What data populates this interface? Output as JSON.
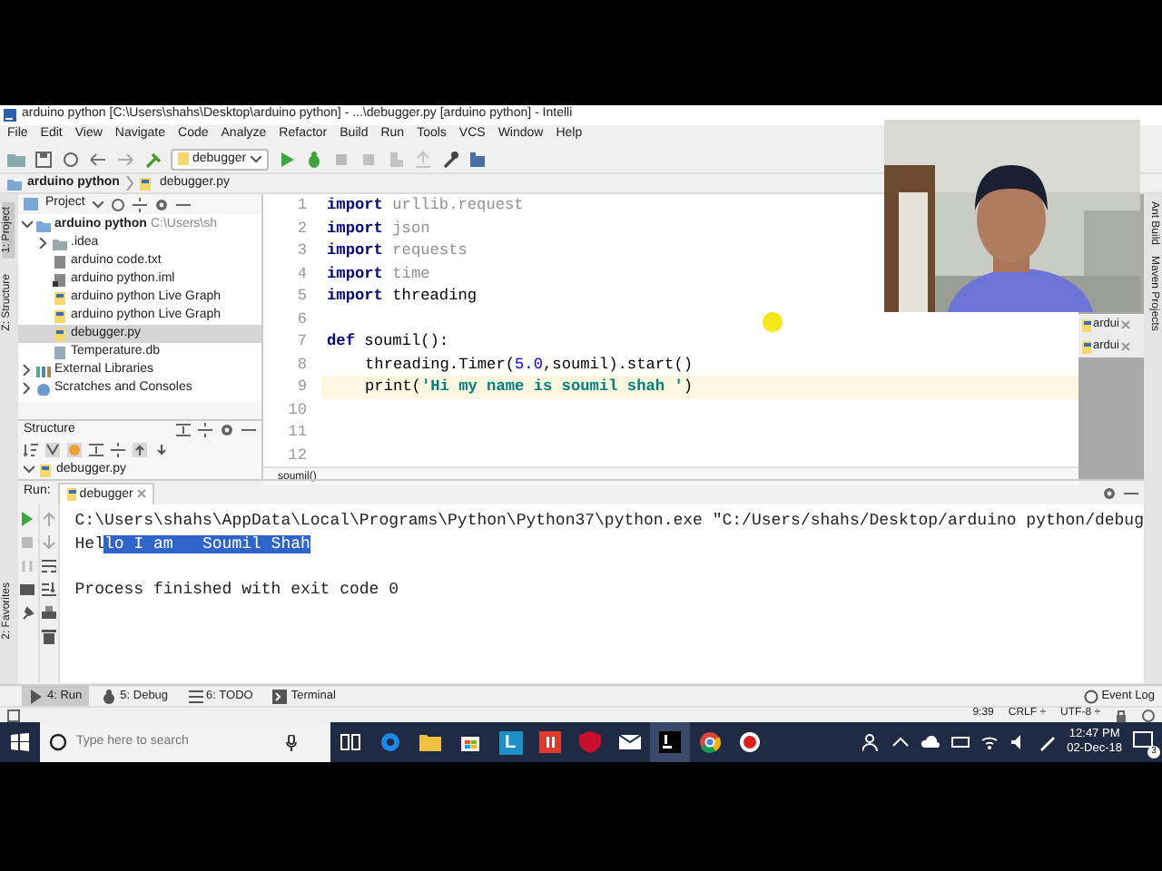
{
  "window": {
    "title": "arduino python [C:\\Users\\shahs\\Desktop\\arduino python] - ...\\debugger.py [arduino python] - Intelli"
  },
  "menu": [
    "File",
    "Edit",
    "View",
    "Navigate",
    "Code",
    "Analyze",
    "Refactor",
    "Build",
    "Run",
    "Tools",
    "VCS",
    "Window",
    "Help"
  ],
  "toolbar": {
    "run_config": "debugger"
  },
  "breadcrumb": [
    "arduino python",
    "debugger.py"
  ],
  "left_strip": [
    {
      "label": "1: Project",
      "selected": true
    },
    {
      "label": "Z: Structure",
      "selected": false
    },
    {
      "label": "2: Favorites",
      "selected": false
    }
  ],
  "project_panel": {
    "title": "Project",
    "tree": [
      {
        "label": "arduino python",
        "path": "C:\\Users\\sh",
        "kind": "project",
        "expanded": true,
        "selected": false,
        "children": [
          {
            "label": ".idea",
            "kind": "folder",
            "expanded": false,
            "selected": false
          },
          {
            "label": "arduino code.txt",
            "kind": "text",
            "selected": false
          },
          {
            "label": "arduino python.iml",
            "kind": "iml",
            "selected": false
          },
          {
            "label": "arduino python Live Graph",
            "kind": "python",
            "selected": false
          },
          {
            "label": "arduino python Live Graph",
            "kind": "python",
            "selected": false
          },
          {
            "label": "debugger.py",
            "kind": "python",
            "selected": true
          },
          {
            "label": "Temperature.db",
            "kind": "db",
            "selected": false
          }
        ]
      },
      {
        "label": "External Libraries",
        "kind": "library",
        "expanded": false,
        "selected": false
      },
      {
        "label": "Scratches and Consoles",
        "kind": "scratch",
        "expanded": false,
        "selected": false
      }
    ]
  },
  "structure_panel": {
    "title": "Structure",
    "items": [
      {
        "label": "debugger.py",
        "expanded": true
      }
    ]
  },
  "editor": {
    "lines": [
      {
        "number": "1",
        "current": false,
        "indented": false,
        "tokens": [
          {
            "text": "import",
            "kind": "keyword"
          },
          {
            "text": "urllib.request",
            "kind": "unused"
          }
        ]
      },
      {
        "number": "2",
        "current": false,
        "indented": false,
        "tokens": [
          {
            "text": "import",
            "kind": "keyword"
          },
          {
            "text": "json",
            "kind": "unused"
          }
        ]
      },
      {
        "number": "3",
        "current": false,
        "indented": false,
        "tokens": [
          {
            "text": "import",
            "kind": "keyword"
          },
          {
            "text": "requests",
            "kind": "unused"
          }
        ]
      },
      {
        "number": "4",
        "current": false,
        "indented": false,
        "tokens": [
          {
            "text": "import",
            "kind": "keyword"
          },
          {
            "text": "time",
            "kind": "unused"
          }
        ]
      },
      {
        "number": "5",
        "current": false,
        "indented": false,
        "tokens": [
          {
            "text": "import",
            "kind": "keyword"
          },
          {
            "text": "threading",
            "kind": "plain"
          }
        ]
      },
      {
        "number": "6",
        "current": false
      },
      {
        "number": "7",
        "current": false,
        "indented": false,
        "tokens": [
          {
            "text": "def",
            "kind": "keyword"
          },
          {
            "text": "soumil():",
            "kind": "plain"
          }
        ]
      },
      {
        "number": "8",
        "current": false,
        "indented": true,
        "tokens": [
          {
            "text": "threading.Timer(",
            "kind": "plain"
          },
          {
            "text": "5.0",
            "kind": "number"
          },
          {
            "text": ",soumil).start()",
            "kind": "plain"
          }
        ]
      },
      {
        "number": "9",
        "current": true,
        "indented": true,
        "tokens": [
          {
            "text": "print(",
            "kind": "plain"
          },
          {
            "text": "'Hi my name is soumil shah '",
            "kind": "string"
          },
          {
            "text": ")",
            "kind": "plain"
          }
        ]
      },
      {
        "number": "10",
        "current": false
      },
      {
        "number": "11",
        "current": false
      },
      {
        "number": "12",
        "current": false
      }
    ],
    "footer": "soumil()"
  },
  "right_panel": {
    "tabs": [
      "ardui",
      "ardui"
    ]
  },
  "right_strip": [
    "Ant Build",
    "Maven Projects"
  ],
  "run_panel": {
    "label": "Run:",
    "tab": "debugger",
    "output": [
      {
        "parts": [
          {
            "text": "C:\\Users\\shahs\\AppData\\Local\\Programs\\Python\\Python37\\python.exe \"C:/Users/shahs/Desktop/arduino python/debug",
            "selected": false
          }
        ]
      },
      {
        "parts": [
          {
            "text": "Hel",
            "selected": false
          },
          {
            "text": "lo I am   Soumil Shah",
            "selected": true
          }
        ]
      },
      {
        "blank_before": true,
        "parts": [
          {
            "text": "Process finished with exit code 0",
            "selected": false
          }
        ]
      }
    ]
  },
  "bottom_tabs": [
    {
      "label": "4: Run",
      "selected": true,
      "kind": "run"
    },
    {
      "label": "5: Debug",
      "selected": false,
      "kind": "debug"
    },
    {
      "label": "6: TODO",
      "selected": false,
      "kind": "todo"
    },
    {
      "label": "Terminal",
      "selected": false,
      "kind": "terminal"
    }
  ],
  "event_log": "Event Log",
  "status_bar": [
    "9:39",
    "CRLF ÷",
    "UTF-8 ÷"
  ],
  "taskbar": {
    "search": {
      "placeholder": "Type here to search"
    },
    "apps": [
      {
        "kind": "taskview",
        "active": false
      },
      {
        "kind": "edge",
        "active": false
      },
      {
        "kind": "folder",
        "active": false
      },
      {
        "kind": "store",
        "active": false
      },
      {
        "kind": "letter",
        "text": "L",
        "color": "#1e90c8",
        "active": false
      },
      {
        "kind": "red",
        "color": "#e03a2a",
        "active": false
      },
      {
        "kind": "shield",
        "color": "#c8102e",
        "active": false
      },
      {
        "kind": "mail",
        "active": false
      },
      {
        "kind": "ide",
        "active": true
      },
      {
        "kind": "chrome",
        "active": false
      },
      {
        "kind": "record",
        "active": false
      }
    ],
    "time": "12:47 PM",
    "date": "02-Dec-18",
    "notifications": "3"
  },
  "webcam": {
    "kind": "picture"
  }
}
